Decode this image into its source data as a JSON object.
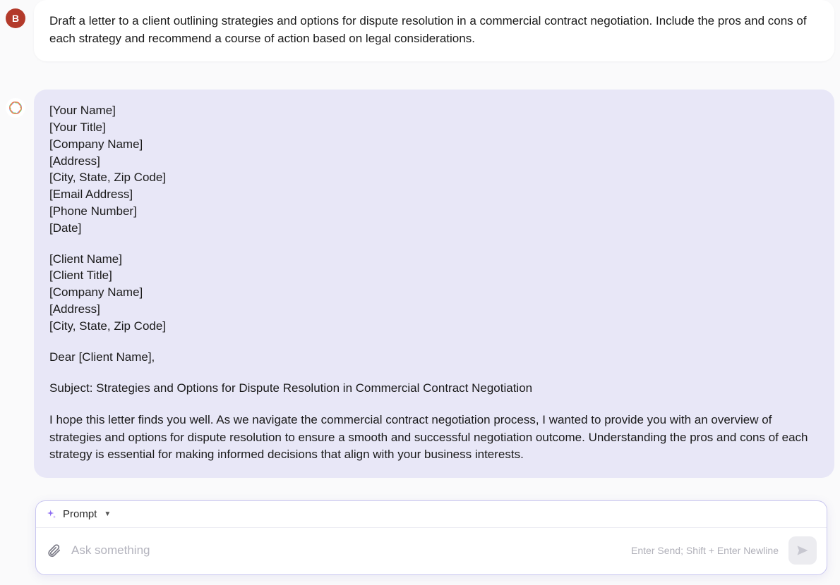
{
  "user": {
    "avatar_letter": "B",
    "message": "Draft a letter to a client outlining strategies and options for dispute resolution in a commercial contract negotiation. Include the pros and cons of each strategy and recommend a course of action based on legal considerations."
  },
  "ai": {
    "sender_block": [
      "[Your Name]",
      "[Your Title]",
      "[Company Name]",
      "[Address]",
      "[City, State, Zip Code]",
      "[Email Address]",
      "[Phone Number]",
      "[Date]"
    ],
    "recipient_block": [
      "[Client Name]",
      "[Client Title]",
      "[Company Name]",
      "[Address]",
      "[City, State, Zip Code]"
    ],
    "salutation": "Dear [Client Name],",
    "subject": "Subject: Strategies and Options for Dispute Resolution in Commercial Contract Negotiation",
    "intro": "I hope this letter finds you well. As we navigate the commercial contract negotiation process, I wanted to provide you with an overview of strategies and options for dispute resolution to ensure a smooth and successful negotiation outcome. Understanding the pros and cons of each strategy is essential for making informed decisions that align with your business interests."
  },
  "composer": {
    "mode_label": "Prompt",
    "placeholder": "Ask something",
    "hint": "Enter Send; Shift + Enter Newline"
  }
}
